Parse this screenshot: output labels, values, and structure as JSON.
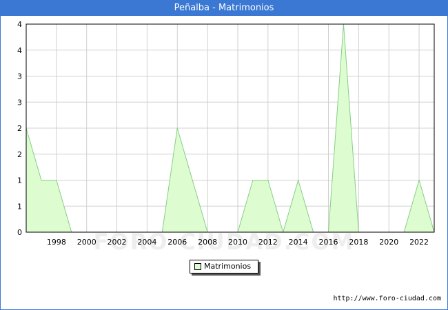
{
  "title": "Peñalba - Matrimonios",
  "footer_url": "http://www.foro-ciudad.com",
  "watermark": "FORO-CIUDAD.COM",
  "colors": {
    "title_bar": "#3a78d4",
    "area_fill": "#ddfdd0",
    "area_line": "#88cc88",
    "grid": "#d0d0d0"
  },
  "chart_data": {
    "type": "area",
    "title": "Peñalba - Matrimonios",
    "x": [
      1996,
      1997,
      1998,
      1999,
      2000,
      2001,
      2002,
      2003,
      2004,
      2005,
      2006,
      2007,
      2008,
      2009,
      2010,
      2011,
      2012,
      2013,
      2014,
      2015,
      2016,
      2017,
      2018,
      2019,
      2020,
      2021,
      2022,
      2023
    ],
    "series": [
      {
        "name": "Matrimonios",
        "values": [
          2,
          1,
          1,
          0,
          0,
          0,
          0,
          0,
          0,
          0,
          2,
          1,
          0,
          0,
          0,
          1,
          1,
          0,
          1,
          0,
          0,
          4,
          0,
          0,
          0,
          0,
          1,
          0
        ]
      }
    ],
    "xlim": [
      1996,
      2023
    ],
    "ylim": [
      0,
      4
    ],
    "x_tick_values": [
      1998,
      2000,
      2002,
      2004,
      2006,
      2008,
      2010,
      2012,
      2014,
      2016,
      2018,
      2020,
      2022
    ],
    "y_tick_labels": [
      "0",
      "1",
      "1",
      "2",
      "2",
      "3",
      "3",
      "4",
      "4"
    ],
    "grid": true,
    "legend_position": "bottom-center"
  }
}
